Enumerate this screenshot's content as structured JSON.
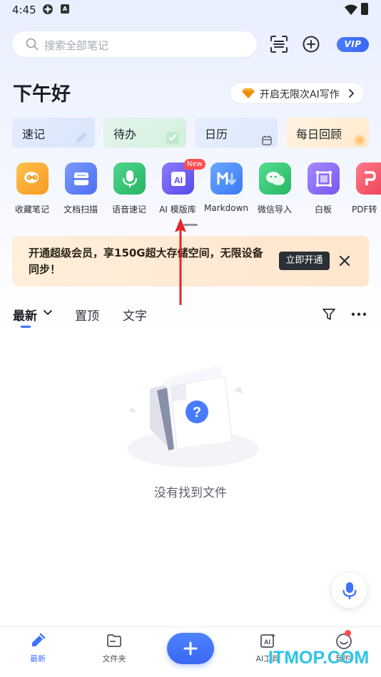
{
  "status_bar": {
    "time": "4:45",
    "notif_letter": "A"
  },
  "search": {
    "placeholder": "搜索全部笔记"
  },
  "header": {
    "vip_label": "VIP"
  },
  "greeting": "下午好",
  "ai_write": {
    "label": "开启无限次AI写作"
  },
  "quick_cards": [
    {
      "label": "速记"
    },
    {
      "label": "待办"
    },
    {
      "label": "日历"
    },
    {
      "label": "每日回顾"
    }
  ],
  "tools": [
    {
      "label": "收藏笔记",
      "icon": "link-icon",
      "color": "#f5a623"
    },
    {
      "label": "文档扫描",
      "icon": "scanner-icon",
      "color": "#5b7cf6"
    },
    {
      "label": "语音速记",
      "icon": "microphone-icon",
      "color": "#37c57a"
    },
    {
      "label": "AI 模版库",
      "icon": "ai-template-icon",
      "color": "#6b5cf0"
    },
    {
      "label": "Markdown",
      "icon": "markdown-icon",
      "color": "#4b8dfa"
    },
    {
      "label": "微信导入",
      "icon": "wechat-icon",
      "color": "#2fc56b"
    },
    {
      "label": "白板",
      "icon": "whiteboard-icon",
      "color": "#8b63f4"
    },
    {
      "label": "PDF转",
      "icon": "pdf-icon",
      "color": "#f4566a"
    }
  ],
  "new_badge": "New",
  "promo": {
    "text": "开通超级会员，享150G超大存储空间，无限设备同步！",
    "button_label": "立即开通"
  },
  "filter_tabs": [
    {
      "label": "最新"
    },
    {
      "label": "置顶"
    },
    {
      "label": "文字"
    }
  ],
  "empty_state": {
    "text": "没有找到文件"
  },
  "bottom_nav": [
    {
      "label": "最新"
    },
    {
      "label": "文件夹"
    },
    {
      "label": "AI工具"
    },
    {
      "label": "我的"
    }
  ],
  "watermark": "ITMOP.COM",
  "colors": {
    "accent": "#3f73ff",
    "annotation": "#e0262b"
  }
}
